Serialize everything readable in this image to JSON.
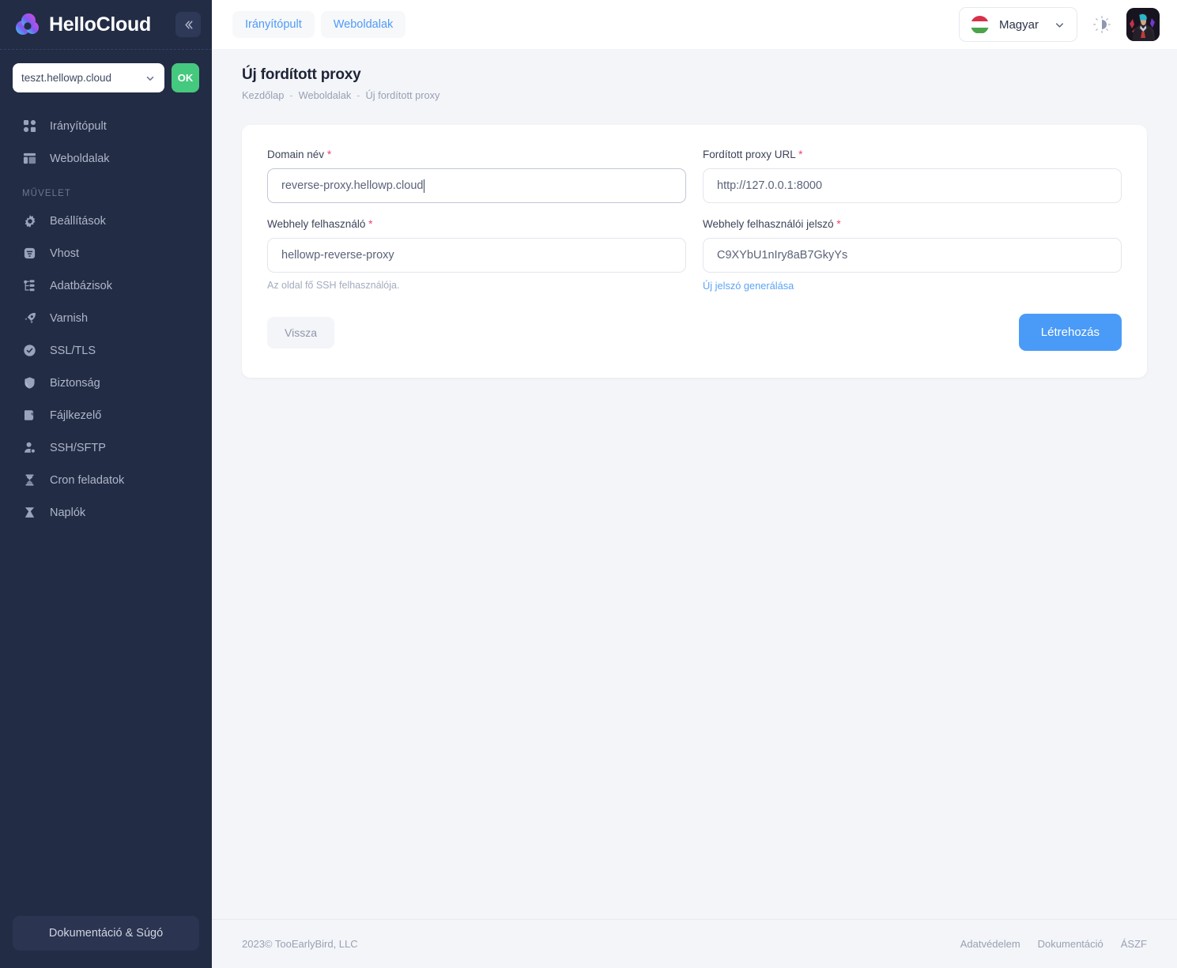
{
  "brand": {
    "name": "HelloCloud",
    "logo_icon": "cloud-logo-icon",
    "collapse_icon": "chevron-double-left-icon"
  },
  "sidebar": {
    "domain_selector": {
      "value": "teszt.hellowp.cloud",
      "caret_icon": "chevron-down-icon"
    },
    "ok_button": "OK",
    "nav_primary": [
      {
        "label": "Irányítópult",
        "icon": "grid-dashboard-icon"
      },
      {
        "label": "Weboldalak",
        "icon": "layout-window-icon"
      }
    ],
    "group_label": "MŰVELET",
    "nav_actions": [
      {
        "label": "Beállítások",
        "icon": "gear-icon"
      },
      {
        "label": "Vhost",
        "icon": "server-lines-icon"
      },
      {
        "label": "Adatbázisok",
        "icon": "database-tree-icon"
      },
      {
        "label": "Varnish",
        "icon": "rocket-icon"
      },
      {
        "label": "SSL/TLS",
        "icon": "shield-check-icon"
      },
      {
        "label": "Biztonság",
        "icon": "shield-icon"
      },
      {
        "label": "Fájlkezelő",
        "icon": "folder-icon"
      },
      {
        "label": "SSH/SFTP",
        "icon": "user-key-icon"
      },
      {
        "label": "Cron feladatok",
        "icon": "hourglass-icon"
      },
      {
        "label": "Naplók",
        "icon": "logs-icon"
      }
    ],
    "docs_button": "Dokumentáció & Súgó"
  },
  "topbar": {
    "tabs": [
      {
        "label": "Irányítópult"
      },
      {
        "label": "Weboldalak"
      }
    ],
    "language": {
      "label": "Magyar",
      "flag_icon": "hungary-flag-icon",
      "caret_icon": "chevron-down-icon"
    },
    "theme_toggle_icon": "sun-theme-icon",
    "avatar_icon": "user-avatar"
  },
  "page": {
    "title": "Új fordított proxy",
    "breadcrumb": [
      {
        "label": "Kezdőlap"
      },
      {
        "label": "Weboldalak"
      },
      {
        "label": "Új fordított proxy"
      }
    ],
    "breadcrumb_separator": "-"
  },
  "form": {
    "domain_name": {
      "label": "Domain név",
      "required_mark": "*",
      "value": "reverse-proxy.hellowp.cloud",
      "focused": true
    },
    "proxy_url": {
      "label": "Fordított proxy URL",
      "required_mark": "*",
      "value": "http://127.0.0.1:8000"
    },
    "site_user": {
      "label": "Webhely felhasználó",
      "required_mark": "*",
      "value": "hellowp-reverse-proxy",
      "help": "Az oldal fő SSH felhasználója."
    },
    "site_password": {
      "label": "Webhely felhasználói jelszó",
      "required_mark": "*",
      "value": "C9XYbU1nIry8aB7GkyYs",
      "generate_link": "Új jelszó generálása"
    },
    "back_button": "Vissza",
    "create_button": "Létrehozás"
  },
  "footer": {
    "copyright": "2023©  TooEarlyBird, LLC",
    "links": [
      {
        "label": "Adatvédelem"
      },
      {
        "label": "Dokumentáció"
      },
      {
        "label": "ÁSZF"
      }
    ]
  },
  "colors": {
    "sidebar_bg": "#232c45",
    "accent_blue": "#4a9bf7",
    "accent_green": "#45c97f",
    "required_red": "#f0426d",
    "page_bg": "#f4f5f8"
  }
}
